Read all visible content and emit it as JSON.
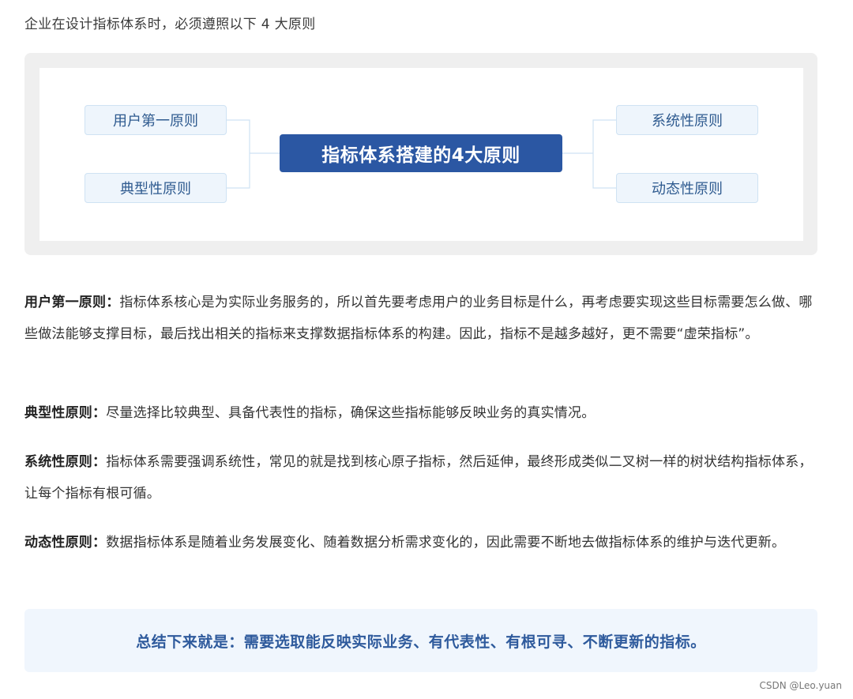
{
  "intro": "企业在设计指标体系时，必须遵照以下 4 大原则",
  "mindmap": {
    "center": "指标体系搭建的4大原则",
    "left": [
      "用户第一原则",
      "典型性原则"
    ],
    "right": [
      "系统性原则",
      "动态性原则"
    ],
    "colors": {
      "center_bg": "#2b57a3",
      "node_bg": "#eef5fc",
      "node_border": "#cfe2f3",
      "node_text": "#2e5a8f",
      "connector": "#cfe2f3"
    }
  },
  "principles": [
    {
      "term": "用户第一原则：",
      "text": "指标体系核心是为实际业务服务的，所以首先要考虑用户的业务目标是什么，再考虑要实现这些目标需要怎么做、哪些做法能够支撑目标，最后找出相关的指标来支撑数据指标体系的构建。因此，指标不是越多越好，更不需要“虚荣指标”。"
    },
    {
      "term": "典型性原则：",
      "text": "尽量选择比较典型、具备代表性的指标，确保这些指标能够反映业务的真实情况。"
    },
    {
      "term": "系统性原则：",
      "text": "指标体系需要强调系统性，常见的就是找到核心原子指标，然后延伸，最终形成类似二叉树一样的树状结构指标体系，让每个指标有根可循。"
    },
    {
      "term": "动态性原则：",
      "text": "数据指标体系是随着业务发展变化、随着数据分析需求变化的，因此需要不断地去做指标体系的维护与迭代更新。"
    }
  ],
  "summary": "总结下来就是：需要选取能反映实际业务、有代表性、有根可寻、不断更新的指标。",
  "watermark": "CSDN @Leo.yuan"
}
